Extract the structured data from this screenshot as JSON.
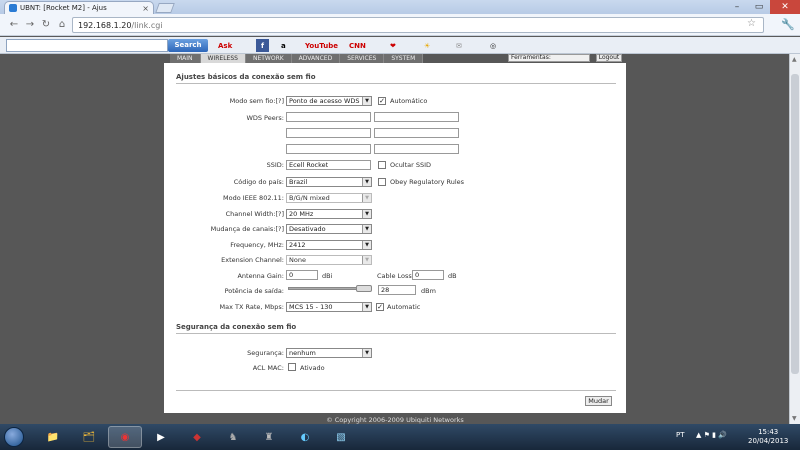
{
  "browser": {
    "tab_title": "UBNT: [Rocket M2] - Ajus",
    "url_host": "192.168.1.20",
    "url_path": "/link.cgi",
    "search_button": "Search",
    "toolbar_items": [
      "Ask",
      "amazon",
      "YouTube",
      "CNN",
      "weather",
      "mail"
    ]
  },
  "top_nav": {
    "tabs": [
      "MAIN",
      "WIRELESS",
      "NETWORK",
      "ADVANCED",
      "SERVICES",
      "SYSTEM"
    ],
    "active_tab": "WIRELESS",
    "tools_select": "Ferramentas:",
    "logout": "Logout"
  },
  "section_basic": {
    "title": "Ajustes básicos da conexão sem fio",
    "wireless_mode": {
      "label": "Modo sem fio:[?]",
      "value": "Ponto de acesso WDS",
      "auto_label": "Automático",
      "auto_checked": true
    },
    "wds_peers": {
      "label": "WDS Peers:"
    },
    "ssid": {
      "label": "SSID:",
      "value": "Ecell Rocket",
      "hide_label": "Ocultar SSID",
      "hide_checked": false
    },
    "country": {
      "label": "Código do país:",
      "value": "Brazil",
      "obey_label": "Obey Regulatory Rules",
      "obey_checked": false
    },
    "ieee_mode": {
      "label": "Modo IEEE 802.11:",
      "value": "B/G/N mixed"
    },
    "channel_width": {
      "label": "Channel Width:[?]",
      "value": "20 MHz"
    },
    "channel_shifting": {
      "label": "Mudança de canais:[?]",
      "value": "Desativado"
    },
    "frequency": {
      "label": "Frequency, MHz:",
      "value": "2412"
    },
    "extension_channel": {
      "label": "Extension Channel:",
      "value": "None"
    },
    "antenna_gain": {
      "label": "Antenna Gain:",
      "value": "0",
      "unit": "dBi"
    },
    "cable_loss": {
      "label": "Cable Loss:",
      "value": "0",
      "unit": "dB"
    },
    "output_power": {
      "label": "Potência de saída:",
      "value": "28",
      "unit": "dBm"
    },
    "max_tx_rate": {
      "label": "Max TX Rate, Mbps:",
      "value": "MCS 15 - 130",
      "auto_label": "Automatic",
      "auto_checked": true
    }
  },
  "section_security": {
    "title": "Segurança da conexão sem fio",
    "security": {
      "label": "Segurança:",
      "value": "nenhum"
    },
    "acl_mac": {
      "label": "ACL MAC:",
      "check_label": "Ativado",
      "checked": false
    }
  },
  "apply_button": "Mudar",
  "copyright": "© Copyright 2006-2009 Ubiquiti Networks",
  "taskbar": {
    "lang": "PT",
    "time": "15:43",
    "date": "20/04/2013"
  }
}
